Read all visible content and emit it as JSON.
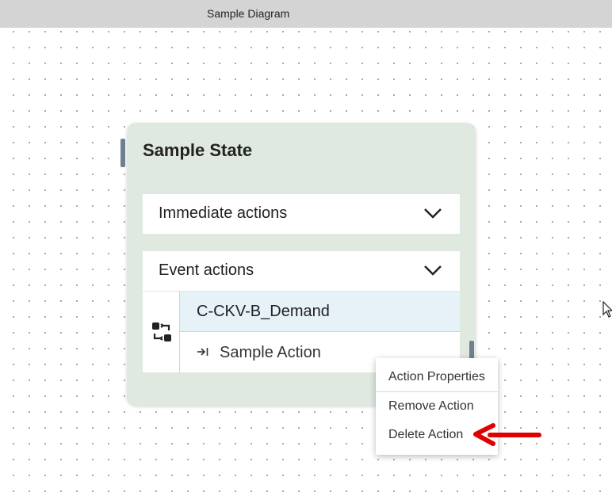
{
  "window": {
    "title": "Sample Diagram"
  },
  "state": {
    "title": "Sample State",
    "sections": {
      "immediate_label": "Immediate actions",
      "event_label": "Event actions"
    },
    "actions": {
      "demand_label": "C-CKV-B_Demand",
      "sample_action_label": "Sample Action"
    }
  },
  "context_menu": {
    "items": [
      "Action Properties",
      "Remove Action",
      "Delete Action"
    ]
  },
  "colors": {
    "state_bg": "#dfe9df",
    "highlight_row": "#e6f1f8",
    "annotation_arrow": "#e00000"
  },
  "icons": [
    "swap-icon",
    "chevron-down-icon",
    "step-into-icon",
    "red-arrow-annotation",
    "mouse-cursor-icon"
  ]
}
